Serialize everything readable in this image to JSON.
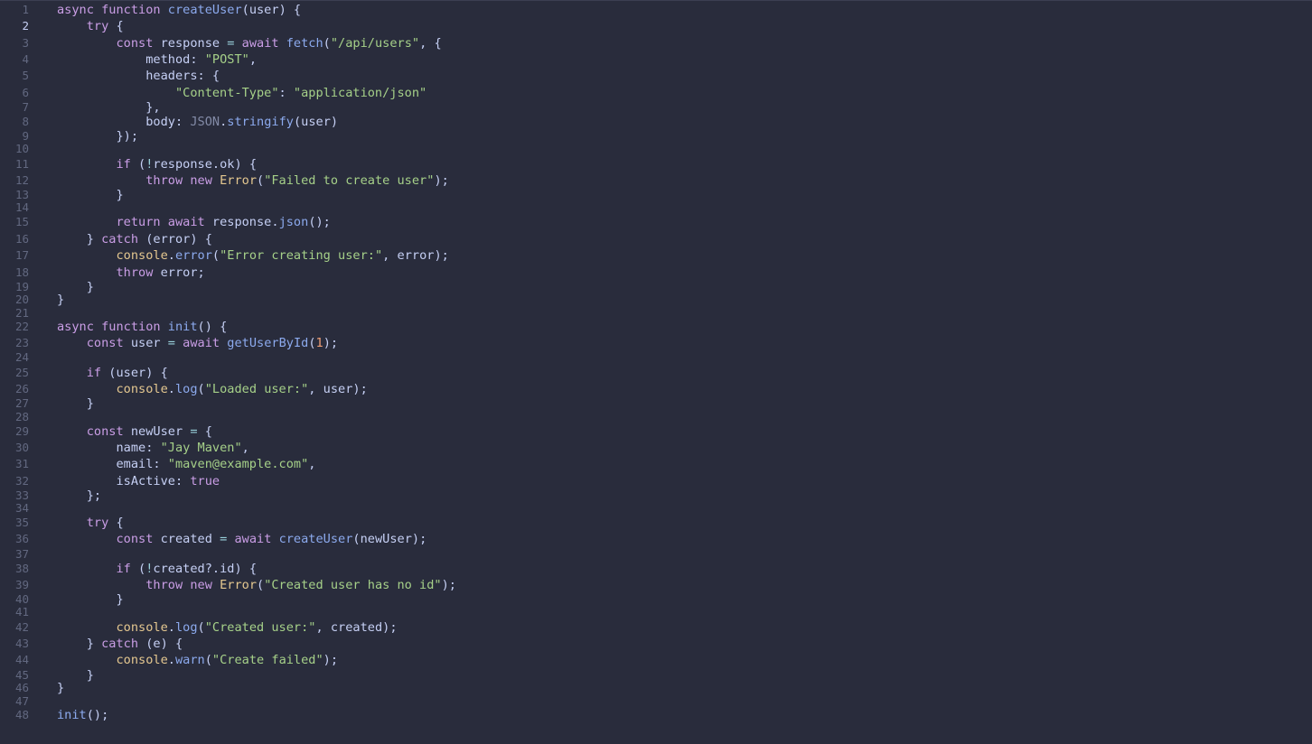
{
  "editor": {
    "active_line": 2,
    "lines": [
      {
        "n": "1",
        "tokens": [
          [
            "kw",
            "async"
          ],
          [
            "sp",
            " "
          ],
          [
            "kw",
            "function"
          ],
          [
            "sp",
            " "
          ],
          [
            "fn",
            "createUser"
          ],
          [
            "punc",
            "("
          ],
          [
            "param",
            "user"
          ],
          [
            "punc",
            ") {"
          ]
        ]
      },
      {
        "n": "2",
        "tokens": [
          [
            "sp",
            "    "
          ],
          [
            "kw",
            "try"
          ],
          [
            "punc",
            " {"
          ]
        ]
      },
      {
        "n": "3",
        "tokens": [
          [
            "sp",
            "        "
          ],
          [
            "kw",
            "const"
          ],
          [
            "sp",
            " "
          ],
          [
            "var",
            "response"
          ],
          [
            "sp",
            " "
          ],
          [
            "op",
            "="
          ],
          [
            "sp",
            " "
          ],
          [
            "kw",
            "await"
          ],
          [
            "sp",
            " "
          ],
          [
            "fn",
            "fetch"
          ],
          [
            "punc",
            "("
          ],
          [
            "str",
            "\"/api/users\""
          ],
          [
            "punc",
            ", {"
          ]
        ]
      },
      {
        "n": "4",
        "tokens": [
          [
            "sp",
            "            "
          ],
          [
            "prop",
            "method"
          ],
          [
            "punc",
            ": "
          ],
          [
            "str",
            "\"POST\""
          ],
          [
            "punc",
            ","
          ]
        ]
      },
      {
        "n": "5",
        "tokens": [
          [
            "sp",
            "            "
          ],
          [
            "prop",
            "headers"
          ],
          [
            "punc",
            ": {"
          ]
        ]
      },
      {
        "n": "6",
        "tokens": [
          [
            "sp",
            "                "
          ],
          [
            "str",
            "\"Content-Type\""
          ],
          [
            "punc",
            ": "
          ],
          [
            "str",
            "\"application/json\""
          ]
        ]
      },
      {
        "n": "7",
        "tokens": [
          [
            "sp",
            "            "
          ],
          [
            "punc",
            "},"
          ]
        ]
      },
      {
        "n": "8",
        "tokens": [
          [
            "sp",
            "            "
          ],
          [
            "prop",
            "body"
          ],
          [
            "punc",
            ": "
          ],
          [
            "global",
            "JSON"
          ],
          [
            "punc",
            "."
          ],
          [
            "fn",
            "stringify"
          ],
          [
            "punc",
            "("
          ],
          [
            "var",
            "user"
          ],
          [
            "punc",
            ")"
          ]
        ]
      },
      {
        "n": "9",
        "tokens": [
          [
            "sp",
            "        "
          ],
          [
            "punc",
            "});"
          ]
        ]
      },
      {
        "n": "10",
        "tokens": []
      },
      {
        "n": "11",
        "tokens": [
          [
            "sp",
            "        "
          ],
          [
            "kw",
            "if"
          ],
          [
            "punc",
            " ("
          ],
          [
            "op",
            "!"
          ],
          [
            "var",
            "response"
          ],
          [
            "punc",
            "."
          ],
          [
            "prop",
            "ok"
          ],
          [
            "punc",
            ") {"
          ]
        ]
      },
      {
        "n": "12",
        "tokens": [
          [
            "sp",
            "            "
          ],
          [
            "kw",
            "throw"
          ],
          [
            "sp",
            " "
          ],
          [
            "kw",
            "new"
          ],
          [
            "sp",
            " "
          ],
          [
            "cls",
            "Error"
          ],
          [
            "punc",
            "("
          ],
          [
            "str",
            "\"Failed to create user\""
          ],
          [
            "punc",
            ");"
          ]
        ]
      },
      {
        "n": "13",
        "tokens": [
          [
            "sp",
            "        "
          ],
          [
            "punc",
            "}"
          ]
        ]
      },
      {
        "n": "14",
        "tokens": []
      },
      {
        "n": "15",
        "tokens": [
          [
            "sp",
            "        "
          ],
          [
            "kw",
            "return"
          ],
          [
            "sp",
            " "
          ],
          [
            "kw",
            "await"
          ],
          [
            "sp",
            " "
          ],
          [
            "var",
            "response"
          ],
          [
            "punc",
            "."
          ],
          [
            "fn",
            "json"
          ],
          [
            "punc",
            "();"
          ]
        ]
      },
      {
        "n": "16",
        "tokens": [
          [
            "sp",
            "    "
          ],
          [
            "punc",
            "} "
          ],
          [
            "kw",
            "catch"
          ],
          [
            "punc",
            " ("
          ],
          [
            "var",
            "error"
          ],
          [
            "punc",
            ") {"
          ]
        ]
      },
      {
        "n": "17",
        "tokens": [
          [
            "sp",
            "        "
          ],
          [
            "builtin",
            "console"
          ],
          [
            "punc",
            "."
          ],
          [
            "fn",
            "error"
          ],
          [
            "punc",
            "("
          ],
          [
            "str",
            "\"Error creating user:\""
          ],
          [
            "punc",
            ", "
          ],
          [
            "var",
            "error"
          ],
          [
            "punc",
            ");"
          ]
        ]
      },
      {
        "n": "18",
        "tokens": [
          [
            "sp",
            "        "
          ],
          [
            "kw",
            "throw"
          ],
          [
            "sp",
            " "
          ],
          [
            "var",
            "error"
          ],
          [
            "punc",
            ";"
          ]
        ]
      },
      {
        "n": "19",
        "tokens": [
          [
            "sp",
            "    "
          ],
          [
            "punc",
            "}"
          ]
        ]
      },
      {
        "n": "20",
        "tokens": [
          [
            "punc",
            "}"
          ]
        ]
      },
      {
        "n": "21",
        "tokens": []
      },
      {
        "n": "22",
        "tokens": [
          [
            "kw",
            "async"
          ],
          [
            "sp",
            " "
          ],
          [
            "kw",
            "function"
          ],
          [
            "sp",
            " "
          ],
          [
            "fn",
            "init"
          ],
          [
            "punc",
            "() {"
          ]
        ]
      },
      {
        "n": "23",
        "tokens": [
          [
            "sp",
            "    "
          ],
          [
            "kw",
            "const"
          ],
          [
            "sp",
            " "
          ],
          [
            "var",
            "user"
          ],
          [
            "sp",
            " "
          ],
          [
            "op",
            "="
          ],
          [
            "sp",
            " "
          ],
          [
            "kw",
            "await"
          ],
          [
            "sp",
            " "
          ],
          [
            "fn",
            "getUserById"
          ],
          [
            "punc",
            "("
          ],
          [
            "num",
            "1"
          ],
          [
            "punc",
            ");"
          ]
        ]
      },
      {
        "n": "24",
        "tokens": []
      },
      {
        "n": "25",
        "tokens": [
          [
            "sp",
            "    "
          ],
          [
            "kw",
            "if"
          ],
          [
            "punc",
            " ("
          ],
          [
            "var",
            "user"
          ],
          [
            "punc",
            ") {"
          ]
        ]
      },
      {
        "n": "26",
        "tokens": [
          [
            "sp",
            "        "
          ],
          [
            "builtin",
            "console"
          ],
          [
            "punc",
            "."
          ],
          [
            "fn",
            "log"
          ],
          [
            "punc",
            "("
          ],
          [
            "str",
            "\"Loaded user:\""
          ],
          [
            "punc",
            ", "
          ],
          [
            "var",
            "user"
          ],
          [
            "punc",
            ");"
          ]
        ]
      },
      {
        "n": "27",
        "tokens": [
          [
            "sp",
            "    "
          ],
          [
            "punc",
            "}"
          ]
        ]
      },
      {
        "n": "28",
        "tokens": []
      },
      {
        "n": "29",
        "tokens": [
          [
            "sp",
            "    "
          ],
          [
            "kw",
            "const"
          ],
          [
            "sp",
            " "
          ],
          [
            "var",
            "newUser"
          ],
          [
            "sp",
            " "
          ],
          [
            "op",
            "="
          ],
          [
            "punc",
            " {"
          ]
        ]
      },
      {
        "n": "30",
        "tokens": [
          [
            "sp",
            "        "
          ],
          [
            "prop",
            "name"
          ],
          [
            "punc",
            ": "
          ],
          [
            "str",
            "\"Jay Maven\""
          ],
          [
            "punc",
            ","
          ]
        ]
      },
      {
        "n": "31",
        "tokens": [
          [
            "sp",
            "        "
          ],
          [
            "prop",
            "email"
          ],
          [
            "punc",
            ": "
          ],
          [
            "str",
            "\"maven@example.com\""
          ],
          [
            "punc",
            ","
          ]
        ]
      },
      {
        "n": "32",
        "tokens": [
          [
            "sp",
            "        "
          ],
          [
            "prop",
            "isActive"
          ],
          [
            "punc",
            ": "
          ],
          [
            "kw",
            "true"
          ]
        ]
      },
      {
        "n": "33",
        "tokens": [
          [
            "sp",
            "    "
          ],
          [
            "punc",
            "};"
          ]
        ]
      },
      {
        "n": "34",
        "tokens": []
      },
      {
        "n": "35",
        "tokens": [
          [
            "sp",
            "    "
          ],
          [
            "kw",
            "try"
          ],
          [
            "punc",
            " {"
          ]
        ]
      },
      {
        "n": "36",
        "tokens": [
          [
            "sp",
            "        "
          ],
          [
            "kw",
            "const"
          ],
          [
            "sp",
            " "
          ],
          [
            "var",
            "created"
          ],
          [
            "sp",
            " "
          ],
          [
            "op",
            "="
          ],
          [
            "sp",
            " "
          ],
          [
            "kw",
            "await"
          ],
          [
            "sp",
            " "
          ],
          [
            "fn",
            "createUser"
          ],
          [
            "punc",
            "("
          ],
          [
            "var",
            "newUser"
          ],
          [
            "punc",
            ");"
          ]
        ]
      },
      {
        "n": "37",
        "tokens": []
      },
      {
        "n": "38",
        "tokens": [
          [
            "sp",
            "        "
          ],
          [
            "kw",
            "if"
          ],
          [
            "punc",
            " ("
          ],
          [
            "op",
            "!"
          ],
          [
            "var",
            "created"
          ],
          [
            "punc",
            "?."
          ],
          [
            "prop",
            "id"
          ],
          [
            "punc",
            ") {"
          ]
        ]
      },
      {
        "n": "39",
        "tokens": [
          [
            "sp",
            "            "
          ],
          [
            "kw",
            "throw"
          ],
          [
            "sp",
            " "
          ],
          [
            "kw",
            "new"
          ],
          [
            "sp",
            " "
          ],
          [
            "cls",
            "Error"
          ],
          [
            "punc",
            "("
          ],
          [
            "str",
            "\"Created user has no id\""
          ],
          [
            "punc",
            ");"
          ]
        ]
      },
      {
        "n": "40",
        "tokens": [
          [
            "sp",
            "        "
          ],
          [
            "punc",
            "}"
          ]
        ]
      },
      {
        "n": "41",
        "tokens": []
      },
      {
        "n": "42",
        "tokens": [
          [
            "sp",
            "        "
          ],
          [
            "builtin",
            "console"
          ],
          [
            "punc",
            "."
          ],
          [
            "fn",
            "log"
          ],
          [
            "punc",
            "("
          ],
          [
            "str",
            "\"Created user:\""
          ],
          [
            "punc",
            ", "
          ],
          [
            "var",
            "created"
          ],
          [
            "punc",
            ");"
          ]
        ]
      },
      {
        "n": "43",
        "tokens": [
          [
            "sp",
            "    "
          ],
          [
            "punc",
            "} "
          ],
          [
            "kw",
            "catch"
          ],
          [
            "punc",
            " ("
          ],
          [
            "var",
            "e"
          ],
          [
            "punc",
            ") {"
          ]
        ]
      },
      {
        "n": "44",
        "tokens": [
          [
            "sp",
            "        "
          ],
          [
            "builtin",
            "console"
          ],
          [
            "punc",
            "."
          ],
          [
            "fn",
            "warn"
          ],
          [
            "punc",
            "("
          ],
          [
            "str",
            "\"Create failed\""
          ],
          [
            "punc",
            ");"
          ]
        ]
      },
      {
        "n": "45",
        "tokens": [
          [
            "sp",
            "    "
          ],
          [
            "punc",
            "}"
          ]
        ]
      },
      {
        "n": "46",
        "tokens": [
          [
            "punc",
            "}"
          ]
        ]
      },
      {
        "n": "47",
        "tokens": []
      },
      {
        "n": "48",
        "tokens": [
          [
            "fn",
            "init"
          ],
          [
            "punc",
            "();"
          ]
        ]
      }
    ]
  }
}
